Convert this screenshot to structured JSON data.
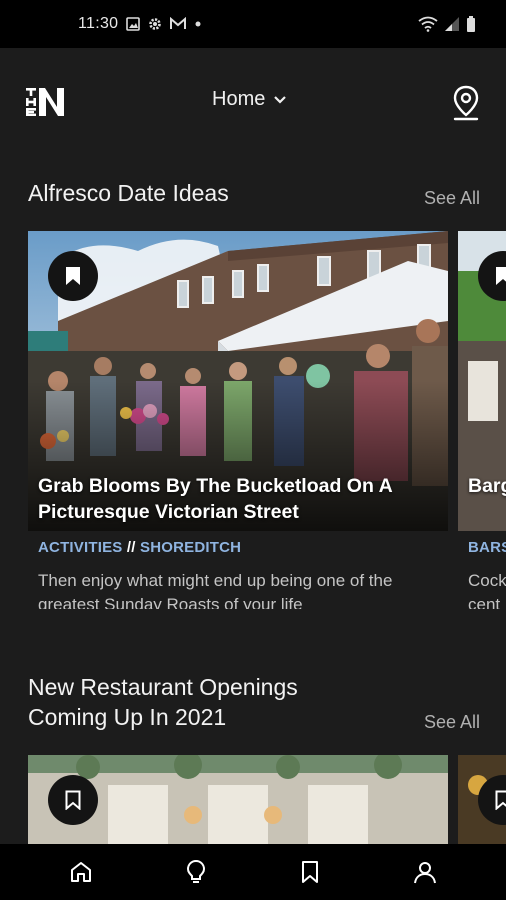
{
  "status_bar": {
    "time": "11:30",
    "left_icons": [
      "image-icon",
      "gear-icon",
      "mail-icon",
      "dot-icon"
    ],
    "right_icons": [
      "wifi-icon",
      "signal-icon",
      "battery-icon"
    ]
  },
  "header": {
    "logo_text": "THE N",
    "location_selector": "Home",
    "location_icon": "map-pin-icon"
  },
  "sections": [
    {
      "title": "Alfresco Date Ideas",
      "see_all": "See All",
      "cards": [
        {
          "title": "Grab Blooms By The Bucketload On A Picturesque Victorian Street",
          "category": "ACTIVITIES",
          "separator": "//",
          "area": "SHOREDITCH",
          "description": "Then enjoy what might end up being one of the greatest Sunday Roasts of your life"
        }
      ],
      "peek_card": {
        "title": "Barg",
        "category": "BARS",
        "description": "Cock cent"
      }
    },
    {
      "title_line1": "New Restaurant Openings",
      "title_line2": "Coming Up In 2021",
      "see_all": "See All"
    }
  ],
  "bottom_nav": [
    {
      "name": "home",
      "icon": "home-icon"
    },
    {
      "name": "ideas",
      "icon": "lightbulb-icon"
    },
    {
      "name": "saved",
      "icon": "bookmark-icon"
    },
    {
      "name": "profile",
      "icon": "user-icon"
    }
  ],
  "colors": {
    "background": "#1c1c1c",
    "tag_blue": "#8fb4e0",
    "nav_bar": "#000000"
  }
}
